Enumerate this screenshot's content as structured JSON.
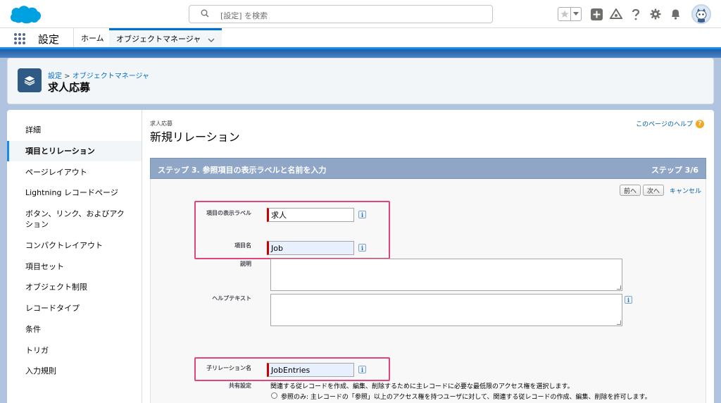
{
  "header": {
    "search_placeholder": "[設定] を検索"
  },
  "nav": {
    "app_name": "設定",
    "tabs": [
      {
        "label": "ホーム"
      },
      {
        "label": "オブジェクトマネージャ"
      }
    ]
  },
  "page_header": {
    "breadcrumb_root": "設定",
    "breadcrumb_sep": " > ",
    "breadcrumb_current": "オブジェクトマネージャ",
    "title": "求人応募"
  },
  "sidebar": {
    "items": [
      {
        "label": "詳細"
      },
      {
        "label": "項目とリレーション"
      },
      {
        "label": "ページレイアウト"
      },
      {
        "label": "Lightning レコードページ"
      },
      {
        "label": "ボタン、リンク、およびアクション"
      },
      {
        "label": "コンパクトレイアウト"
      },
      {
        "label": "項目セット"
      },
      {
        "label": "オブジェクト制限"
      },
      {
        "label": "レコードタイプ"
      },
      {
        "label": "条件"
      },
      {
        "label": "トリガ"
      },
      {
        "label": "入力規則"
      }
    ]
  },
  "content": {
    "object_label": "求人応募",
    "page_title": "新規リレーション",
    "help_link": "このページのヘルプ",
    "step_title": "ステップ 3. 参照項目の表示ラベルと名前を入力",
    "step_count": "ステップ 3/6",
    "buttons": {
      "prev": "前へ",
      "next": "次へ",
      "cancel": "キャンセル"
    },
    "fields": {
      "label_label": "項目の表示ラベル",
      "label_value": "求人",
      "name_label": "項目名",
      "name_value": "Job",
      "description_label": "説明",
      "help_text_label": "ヘルプテキスト",
      "child_rel_label": "子リレーション名",
      "child_rel_value": "JobEntries",
      "sharing_label": "共有設定",
      "sharing_desc": "関連する従レコードを作成、編集、削除するために主レコードに必要な最低限のアクセス権を選択します。",
      "sharing_option1": "参照のみ: 主レコードの「参照」以上のアクセス権を持つユーザに対して、関連する従レコードの作成、編集、削除を許可します。"
    }
  }
}
